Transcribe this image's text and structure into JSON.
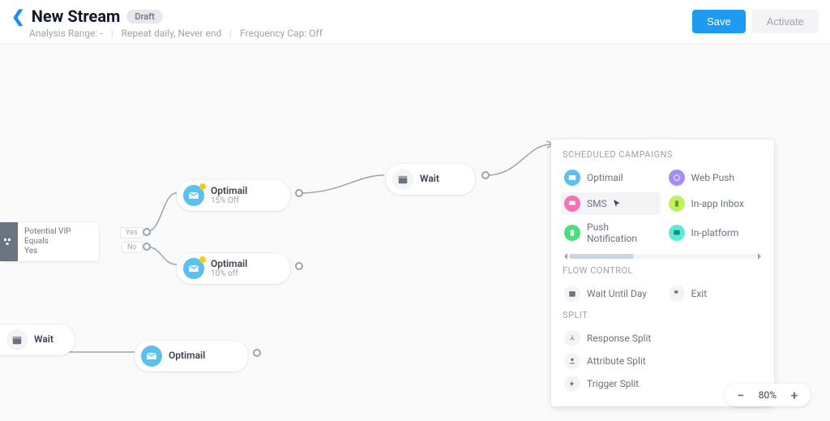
{
  "header": {
    "title": "New Stream",
    "badge": "Draft",
    "analysis_range_label": "Analysis Range: -",
    "repeat_label": "Repeat daily, Never end",
    "freq_cap_label": "Frequency Cap: Off",
    "save_label": "Save",
    "activate_label": "Activate"
  },
  "canvas": {
    "decision": {
      "title": "Potential VIP Equals",
      "value": "Yes",
      "yes": "Yes",
      "no": "No"
    },
    "nodes": {
      "optimail1": {
        "title": "Optimail",
        "sub": "15% Off"
      },
      "optimail2": {
        "title": "Optimail",
        "sub": "10% off"
      },
      "optimail3": {
        "title": "Optimail"
      },
      "wait_top": {
        "title": "Wait"
      },
      "wait_left": {
        "title": "Wait"
      }
    }
  },
  "palette": {
    "scheduled_title": "SCHEDULED CAMPAIGNS",
    "items_scheduled": [
      {
        "label": "Optimail",
        "color": "blue",
        "icon": "mail"
      },
      {
        "label": "Web Push",
        "color": "purple",
        "icon": "globe"
      },
      {
        "label": "SMS",
        "color": "pink",
        "icon": "chat",
        "hover": true
      },
      {
        "label": "In-app Inbox",
        "color": "lime",
        "icon": "phone"
      },
      {
        "label": "Push Notification",
        "color": "green",
        "icon": "phone"
      },
      {
        "label": "In-platform",
        "color": "teal",
        "icon": "layout"
      }
    ],
    "flow_title": "FLOW CONTROL",
    "items_flow": [
      {
        "label": "Wait Until Day",
        "icon": "calendar"
      },
      {
        "label": "Exit",
        "icon": "flag"
      }
    ],
    "split_title": "SPLIT",
    "items_split": [
      {
        "label": "Response Split",
        "icon": "branch"
      },
      {
        "label": "Attribute Split",
        "icon": "person"
      },
      {
        "label": "Trigger Split",
        "icon": "bolt"
      }
    ]
  },
  "zoom": {
    "value": "80%"
  }
}
